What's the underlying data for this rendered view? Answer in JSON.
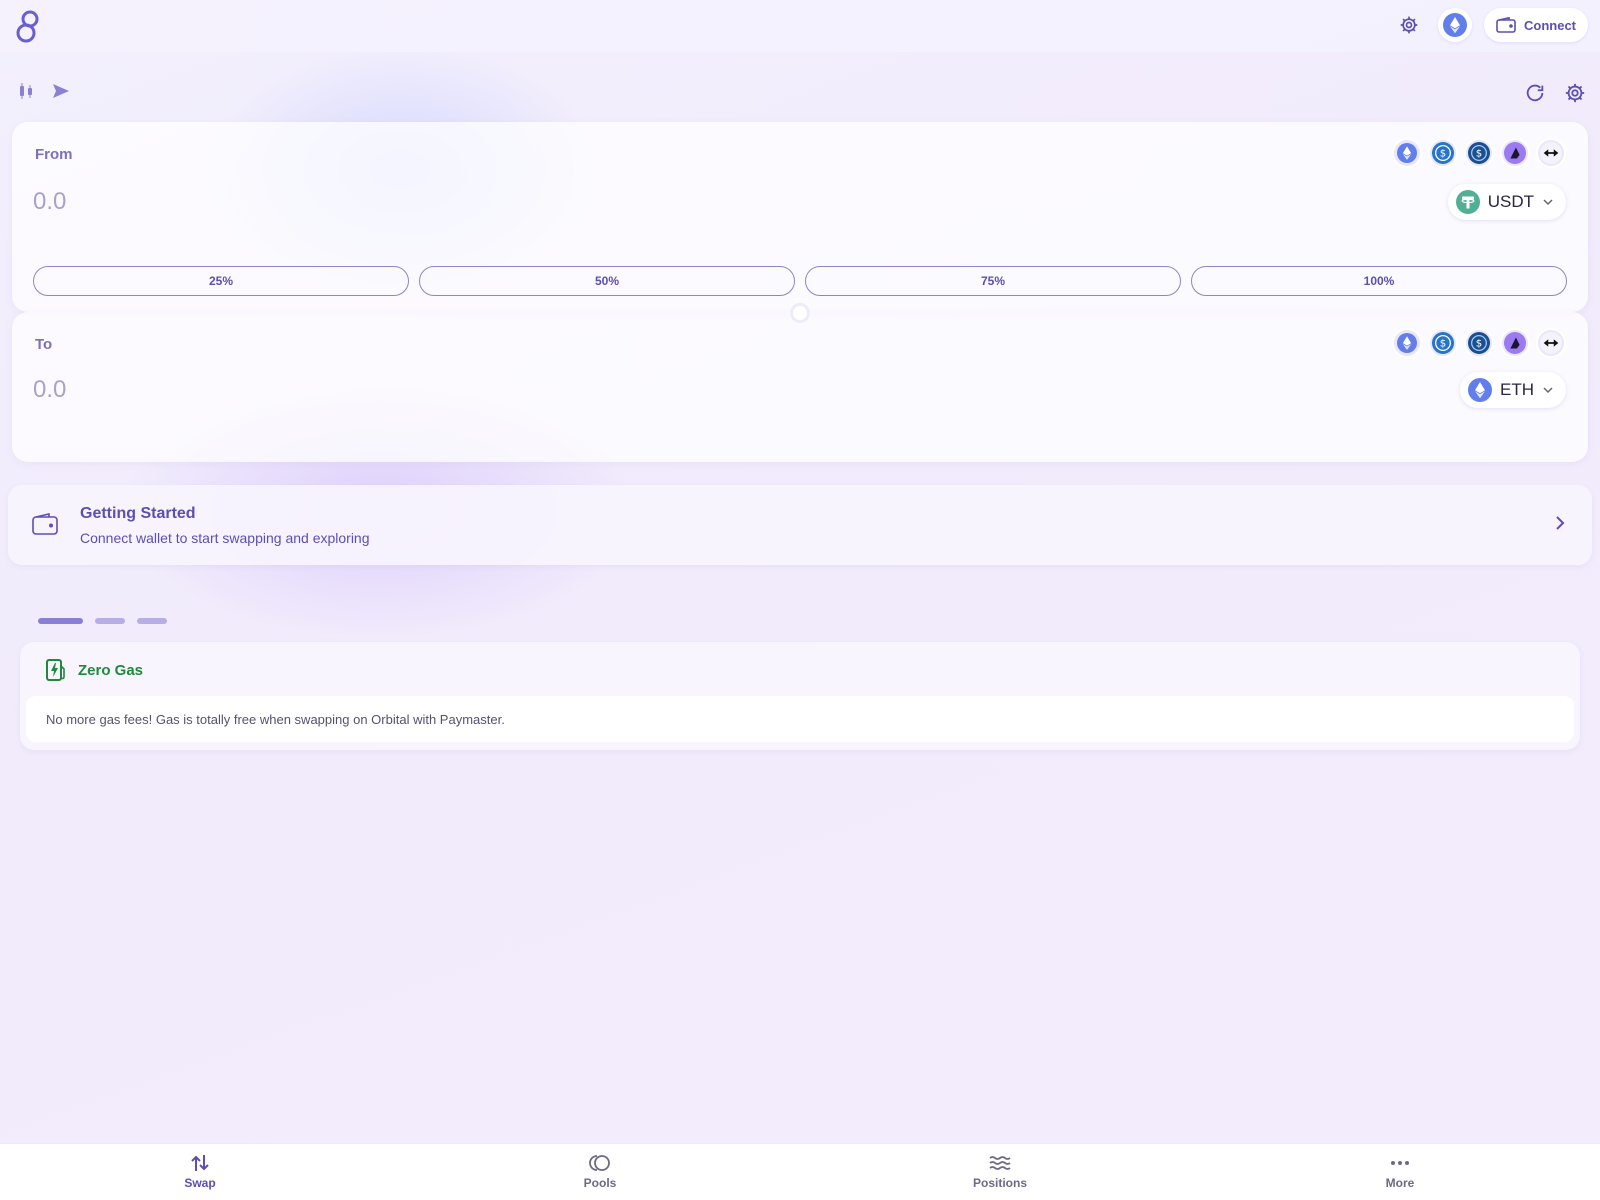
{
  "header": {
    "connect_label": "Connect"
  },
  "from": {
    "label": "From",
    "amount_placeholder": "0.0",
    "token": "USDT",
    "quick_tokens": [
      "eth-icon",
      "usdc-icon",
      "usdc-bridged-icon",
      "arbitrum-icon",
      "bridge-arrows-icon"
    ],
    "percent_buttons": [
      "25%",
      "50%",
      "75%",
      "100%"
    ]
  },
  "to": {
    "label": "To",
    "amount_placeholder": "0.0",
    "token": "ETH",
    "quick_tokens": [
      "eth-icon",
      "usdc-icon",
      "usdc-bridged-icon",
      "arbitrum-icon",
      "bridge-arrows-icon"
    ]
  },
  "getting_started": {
    "title": "Getting Started",
    "subtitle": "Connect wallet to start swapping and exploring"
  },
  "carousel": {
    "dots": 3,
    "active": 0
  },
  "feature": {
    "title": "Zero Gas",
    "body": "No more gas fees! Gas is totally free when swapping on Orbital with Paymaster."
  },
  "nav": {
    "items": [
      {
        "label": "Swap",
        "icon": "swap-icon",
        "active": true
      },
      {
        "label": "Pools",
        "icon": "pools-icon",
        "active": false
      },
      {
        "label": "Positions",
        "icon": "positions-icon",
        "active": false
      },
      {
        "label": "More",
        "icon": "more-icon",
        "active": false
      }
    ]
  },
  "colors": {
    "accent": "#5b4fb3",
    "success": "#1e8a3c",
    "eth": "#627eea",
    "usdt": "#50af95",
    "usdc": "#2775ca"
  }
}
